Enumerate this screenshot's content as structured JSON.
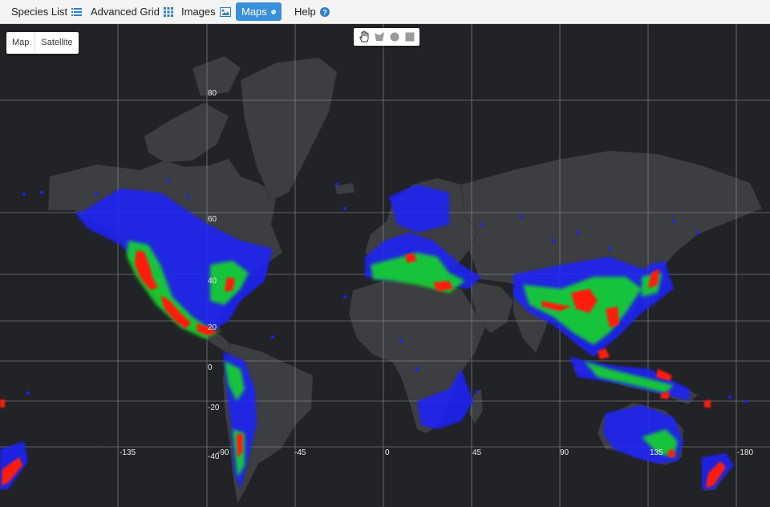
{
  "nav": {
    "species_list": "Species List",
    "advanced_grid": "Advanced Grid",
    "images": "Images",
    "maps": "Maps",
    "help": "Help",
    "active": "Maps"
  },
  "map_type": {
    "map": "Map",
    "satellite": "Satellite"
  },
  "draw_tools": [
    "hand-icon",
    "polygon-icon",
    "circle-icon",
    "rectangle-icon"
  ],
  "graticule": {
    "lat_labels": [
      "80",
      "60",
      "40",
      "20",
      "0",
      "-20",
      "-40"
    ],
    "lon_labels": [
      "-135",
      "-90",
      "-45",
      "0",
      "45",
      "90",
      "135",
      "-180"
    ]
  },
  "colors": {
    "accent": "#3a8fd9",
    "background": "#222326",
    "land": "#3d3e41",
    "heat_low": "#1a22ff",
    "heat_mid": "#17d62a",
    "heat_high": "#ff1f10"
  }
}
